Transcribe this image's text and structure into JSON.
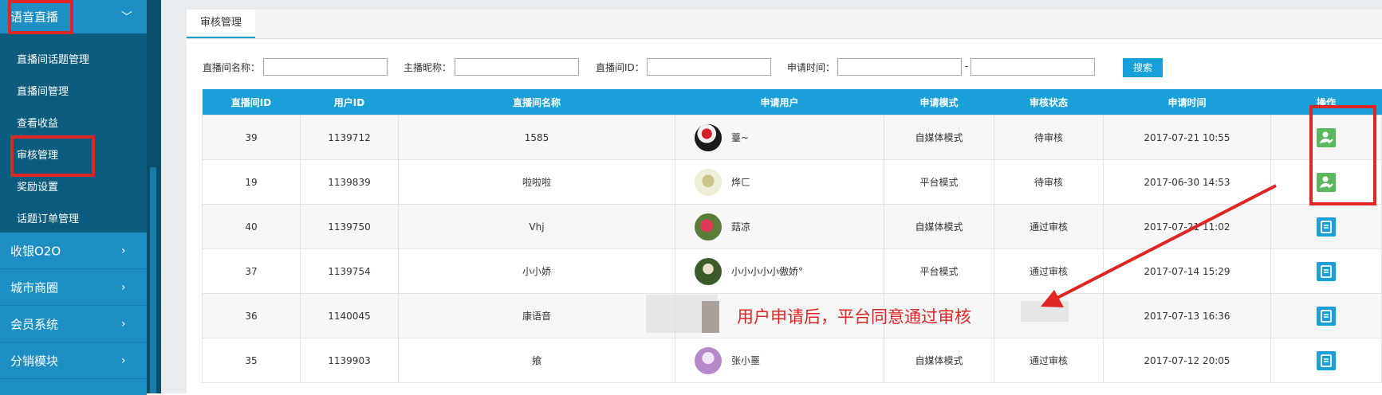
{
  "sidebar": {
    "active_menu": "语音直播",
    "sub_items": [
      "直播间话题管理",
      "直播间管理",
      "查看收益",
      "审核管理",
      "奖励设置",
      "话题订单管理"
    ],
    "menus": [
      "收银O2O",
      "城市商圈",
      "会员系统",
      "分销模块"
    ],
    "icons": {
      "expanded": "chevron-down-icon",
      "collapsed": "chevron-right-icon"
    }
  },
  "tabs": {
    "active": "审核管理"
  },
  "filters": {
    "room_name_label": "直播间名称：",
    "anchor_label": "主播昵称：",
    "room_id_label": "直播间ID：",
    "time_label": "申请时间：",
    "range_sep": "-",
    "search_label": "搜索"
  },
  "table": {
    "headers": [
      "直播间ID",
      "用户ID",
      "直播间名称",
      "申请用户",
      "申请模式",
      "审核状态",
      "申请时间",
      "操作"
    ],
    "rows": [
      {
        "room_id": "39",
        "user_id": "1139712",
        "room_name": "1585",
        "user": "薹~",
        "mode": "自媒体模式",
        "status": "待审核",
        "time": "2017-07-21 10:55",
        "action": "approve-icon"
      },
      {
        "room_id": "19",
        "user_id": "1139839",
        "room_name": "啦啦啦",
        "user": "烨ㄈ",
        "mode": "平台模式",
        "status": "待审核",
        "time": "2017-06-30 14:53",
        "action": "approve-icon"
      },
      {
        "room_id": "40",
        "user_id": "1139750",
        "room_name": "Vhj",
        "user": "菇凉",
        "mode": "自媒体模式",
        "status": "通过审核",
        "time": "2017-07-21 11:02",
        "action": "view-icon"
      },
      {
        "room_id": "37",
        "user_id": "1139754",
        "room_name": "小小娇",
        "user": "小小小小小傲娇°",
        "mode": "平台模式",
        "status": "通过审核",
        "time": "2017-07-14 15:29",
        "action": "view-icon"
      },
      {
        "room_id": "36",
        "user_id": "1140045",
        "room_name": "康语音",
        "user": "",
        "mode": "",
        "status": "",
        "time": "2017-07-13 16:36",
        "action": "view-icon"
      },
      {
        "room_id": "35",
        "user_id": "1139903",
        "room_name": "飨",
        "user": "张小噩",
        "mode": "自媒体模式",
        "status": "通过审核",
        "time": "2017-07-12 20:05",
        "action": "view-icon"
      }
    ]
  },
  "annotation": {
    "text": "用户申请后，平台同意通过审核"
  },
  "colors": {
    "sidebar": "#106b8e",
    "accent": "#1aa0d8",
    "highlight": "#e02525",
    "approve": "#5cb85c"
  }
}
